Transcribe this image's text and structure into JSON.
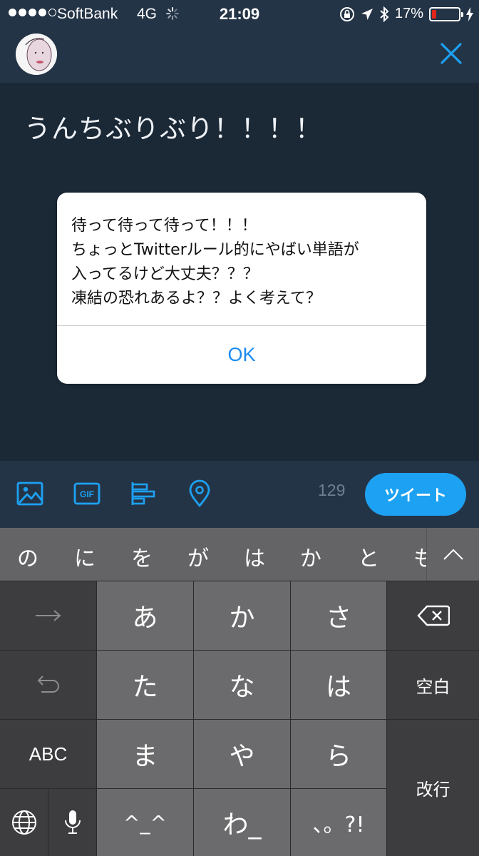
{
  "status_bar": {
    "carrier": "SoftBank",
    "network": "4G",
    "time": "21:09",
    "battery_percent_label": "17%",
    "battery_level": 0.17,
    "battery_color": "#e0261c"
  },
  "header": {
    "avatar_icon": "profile-avatar",
    "close_icon": "close-icon"
  },
  "compose": {
    "text": "うんちぶりぶり！！！！"
  },
  "alert": {
    "lines": [
      "待って待って待って！！！",
      "ちょっとTwitterルール的にやばい単語が",
      "入ってるけど大丈夫？？？",
      "凍結の恐れあるよ？？よく考えて？"
    ],
    "ok_label": "OK"
  },
  "toolbar": {
    "icons": [
      "image-icon",
      "gif-icon",
      "poll-icon",
      "location-icon"
    ],
    "gif_label": "GIF",
    "char_count": "129",
    "tweet_label": "ツイート",
    "accent": "#1da1f2"
  },
  "keyboard": {
    "candidates": [
      "の",
      "に",
      "を",
      "が",
      "は",
      "か",
      "と",
      "も"
    ],
    "rows": [
      [
        "あ",
        "か",
        "さ"
      ],
      [
        "た",
        "な",
        "は"
      ],
      [
        "ま",
        "や",
        "ら"
      ],
      [
        "^_^",
        "わ_",
        "、。?!"
      ]
    ],
    "space_label": "空白",
    "return_label": "改行",
    "abc_label": "ABC"
  }
}
